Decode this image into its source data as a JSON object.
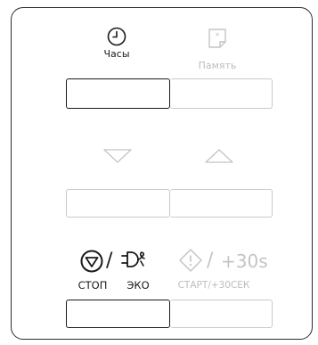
{
  "panel": {
    "clock": {
      "label": "Часы",
      "icon": "clock-icon",
      "active": true
    },
    "memory": {
      "label": "Память",
      "icon": "memory-star-icon",
      "active": false
    },
    "down_arrow": {
      "icon": "triangle-down-icon",
      "active": false
    },
    "up_arrow": {
      "icon": "triangle-up-icon",
      "active": false
    },
    "stop_eco": {
      "stop_label": "СТОП",
      "eco_label": "ЭКО",
      "separator": "/",
      "stop_icon": "stop-icon",
      "eco_icon": "eco-plug-icon",
      "active": true
    },
    "start": {
      "label": "СТАРТ/+30СЕК",
      "separator": "/",
      "plus_text": "+30s",
      "icon": "start-diamond-icon",
      "active": false
    }
  },
  "colors": {
    "active": "#1a1a1a",
    "inactive": "#c4c4c4",
    "border": "#2b2b2b"
  }
}
